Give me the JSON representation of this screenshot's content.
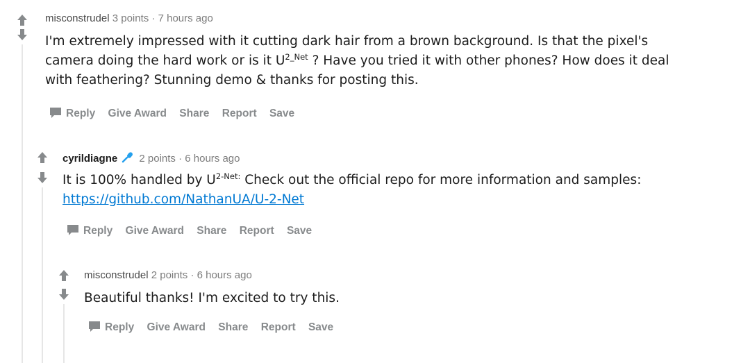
{
  "colors": {
    "arrow": "#878a8c",
    "link": "#0079d3",
    "mic": "#24a0ed"
  },
  "comments": [
    {
      "author": "misconstrudel",
      "points": "3 points",
      "sep": "·",
      "time": "7 hours ago",
      "line1": "I'm extremely impressed with it cutting dark hair from a brown background. Is that the pixel's",
      "line2_pre": "camera doing the hard work or is it U",
      "line2_sup": "2_Net",
      "line2_post": " ? Have you tried it with other phones? How does it deal",
      "line3": "with feathering? Stunning demo & thanks for posting this.",
      "actions": {
        "reply": "Reply",
        "award": "Give Award",
        "share": "Share",
        "report": "Report",
        "save": "Save"
      }
    },
    {
      "author": "cyrildiagne",
      "flair_icon": "microphone-icon",
      "points": "2 points",
      "sep": "·",
      "time": "6 hours ago",
      "line1_pre": "It is 100% handled by U",
      "line1_sup": "2-Net:",
      "line1_post": " Check out the official repo for more information and samples:",
      "link": "https://github.com/NathanUA/U-2-Net",
      "actions": {
        "reply": "Reply",
        "award": "Give Award",
        "share": "Share",
        "report": "Report",
        "save": "Save"
      }
    },
    {
      "author": "misconstrudel",
      "points": "2 points",
      "sep": "·",
      "time": "6 hours ago",
      "line1": "Beautiful thanks! I'm excited to try this.",
      "actions": {
        "reply": "Reply",
        "award": "Give Award",
        "share": "Share",
        "report": "Report",
        "save": "Save"
      }
    }
  ]
}
